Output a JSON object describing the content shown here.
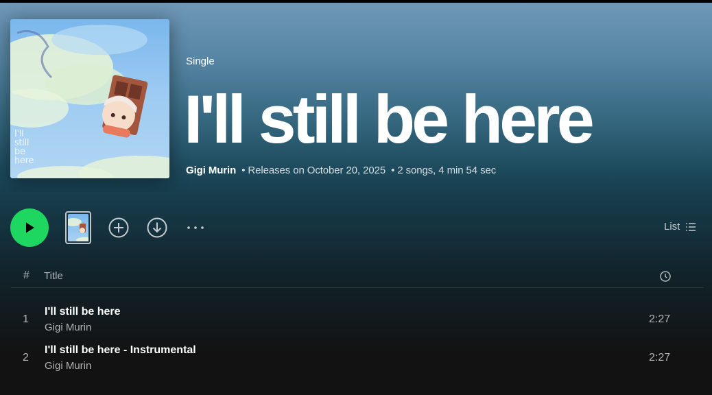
{
  "album": {
    "type_label": "Single",
    "title": "I'll still be here",
    "artist": "Gigi Murin",
    "release_text": "Releases on October 20, 2025",
    "summary": "2 songs, 4 min 54 sec",
    "separator": "•",
    "cover_text": "I'll\nstill\nbe\nhere"
  },
  "actions": {
    "play": "play-icon",
    "add": "add-circle-icon",
    "download": "download-circle-icon",
    "more": "more-horizontal-icon",
    "view_label": "List",
    "view_icon": "list-icon"
  },
  "table": {
    "header_num": "#",
    "header_title": "Title",
    "header_duration_icon": "clock-icon"
  },
  "tracks": [
    {
      "num": "1",
      "title": "I'll still be here",
      "artist": "Gigi Murin",
      "duration": "2:27"
    },
    {
      "num": "2",
      "title": "I'll still be here - Instrumental",
      "artist": "Gigi Murin",
      "duration": "2:27"
    }
  ],
  "colors": {
    "accent_green": "#1ed760",
    "hero_top": "#6f98b7",
    "hero_bottom": "#173f50",
    "background": "#121212"
  }
}
